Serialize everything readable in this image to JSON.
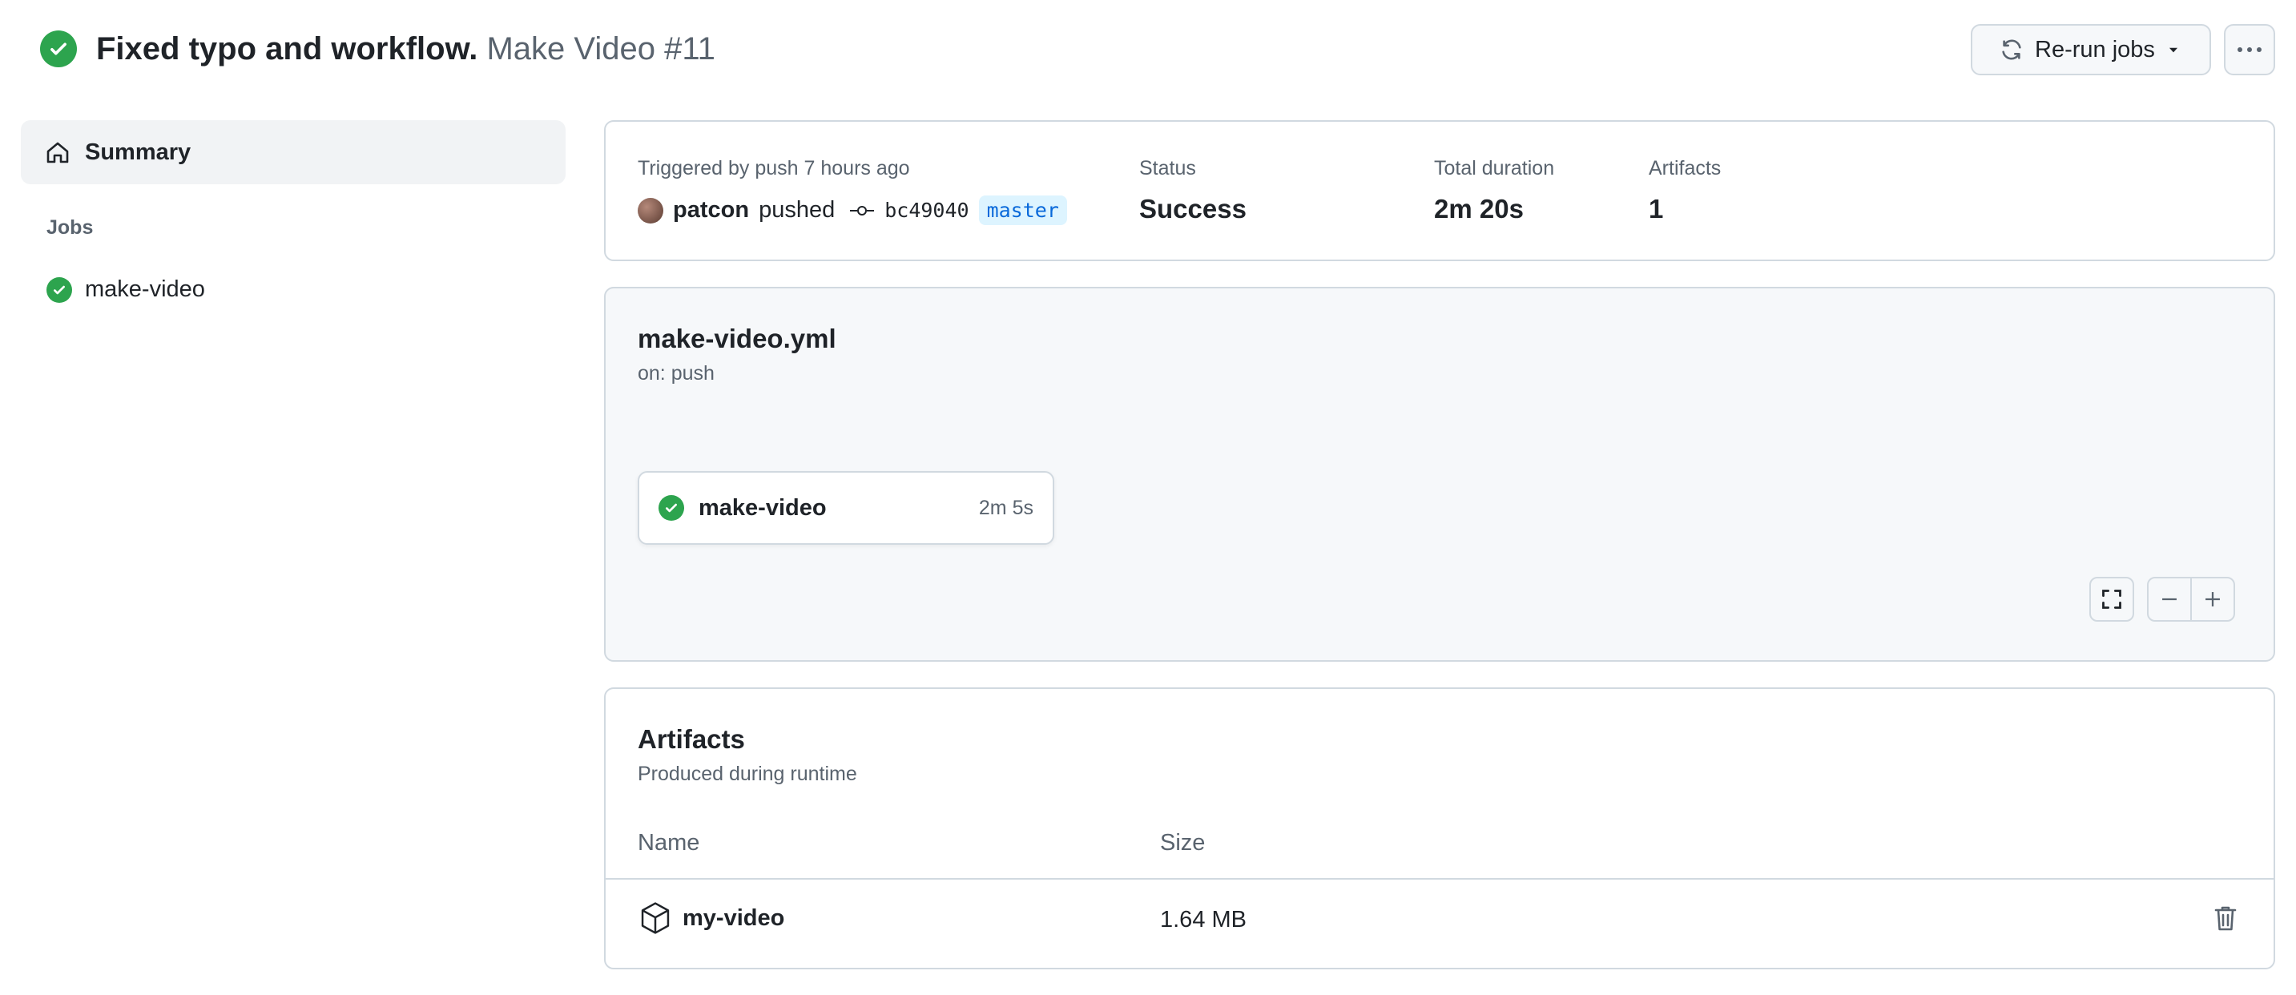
{
  "header": {
    "title_bold": "Fixed typo and workflow.",
    "title_light": "Make Video #11",
    "rerun_label": "Re-run jobs",
    "status_color": "#2da44e"
  },
  "sidebar": {
    "summary_label": "Summary",
    "jobs_heading": "Jobs",
    "jobs": [
      {
        "label": "make-video",
        "status": "success"
      }
    ]
  },
  "summary": {
    "trigger_label": "Triggered by push 7 hours ago",
    "user": "patcon",
    "action": "pushed",
    "commit_sha": "bc49040",
    "branch": "master",
    "status_label": "Status",
    "status_value": "Success",
    "duration_label": "Total duration",
    "duration_value": "2m 20s",
    "artifacts_label": "Artifacts",
    "artifacts_value": "1"
  },
  "workflow": {
    "file": "make-video.yml",
    "trigger": "on: push",
    "job_name": "make-video",
    "job_duration": "2m 5s"
  },
  "artifacts": {
    "title": "Artifacts",
    "subtitle": "Produced during runtime",
    "col_name": "Name",
    "col_size": "Size",
    "rows": [
      {
        "name": "my-video",
        "size": "1.64 MB"
      }
    ]
  },
  "icons": {
    "header_status": "check-circle-icon",
    "rerun": "sync-icon",
    "dropdown": "triangle-down-icon",
    "more": "kebab-horizontal-icon",
    "summary": "home-icon",
    "commit": "git-commit-icon",
    "fullscreen": "screen-full-icon",
    "zoom_out": "dash-icon",
    "zoom_in": "plus-icon",
    "artifact": "package-icon",
    "delete": "trash-icon"
  }
}
